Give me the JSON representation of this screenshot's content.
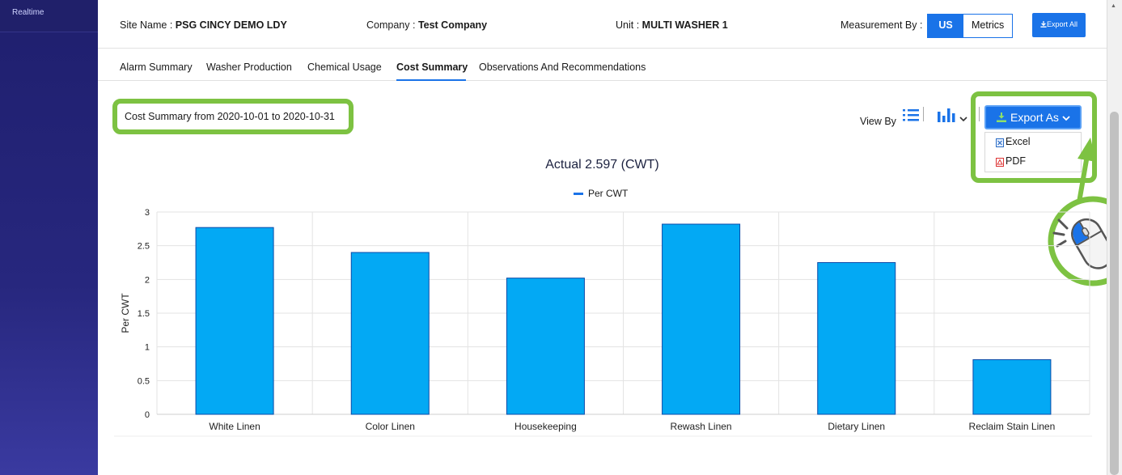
{
  "sidebar": {
    "items": [
      {
        "label": "Realtime"
      }
    ]
  },
  "header": {
    "site_label": "Site Name :",
    "site_value": "PSG CINCY DEMO LDY",
    "company_label": "Company :",
    "company_value": "Test Company",
    "unit_label": "Unit :",
    "unit_value": "MULTI WASHER 1",
    "measurement_label": "Measurement By :",
    "measurement_options": [
      "US",
      "Metrics"
    ],
    "measurement_selected": "US",
    "export_all_label": "Export All"
  },
  "tabs": [
    {
      "label": "Alarm Summary"
    },
    {
      "label": "Washer Production"
    },
    {
      "label": "Chemical Usage"
    },
    {
      "label": "Cost Summary",
      "active": true
    },
    {
      "label": "Observations And Recommendations"
    }
  ],
  "summary": {
    "title": "Cost Summary from 2020-10-01 to 2020-10-31"
  },
  "toolbar": {
    "view_by_label": "View By",
    "export_as_label": "Export As",
    "export_menu": [
      {
        "label": "Excel",
        "icon": "excel-file-icon"
      },
      {
        "label": "PDF",
        "icon": "pdf-file-icon"
      }
    ]
  },
  "colors": {
    "accent": "#1a73e8",
    "bar": "#03a9f4",
    "highlight": "#7dc242",
    "sidebar": "#27277e"
  },
  "chart_data": {
    "type": "bar",
    "title": "Actual 2.597 (CWT)",
    "ylabel": "Per CWT",
    "xlabel": "",
    "ylim": [
      0,
      3
    ],
    "yticks": [
      "0",
      "0.5",
      "1",
      "1.5",
      "2",
      "2.5",
      "3"
    ],
    "categories": [
      "White Linen",
      "Color Linen",
      "Housekeeping",
      "Rewash Linen",
      "Dietary Linen",
      "Reclaim Stain Linen"
    ],
    "series": [
      {
        "name": "Per CWT",
        "values": [
          2.77,
          2.4,
          2.02,
          2.82,
          2.25,
          0.81
        ]
      }
    ],
    "legend_position": "top-center",
    "grid": true
  }
}
